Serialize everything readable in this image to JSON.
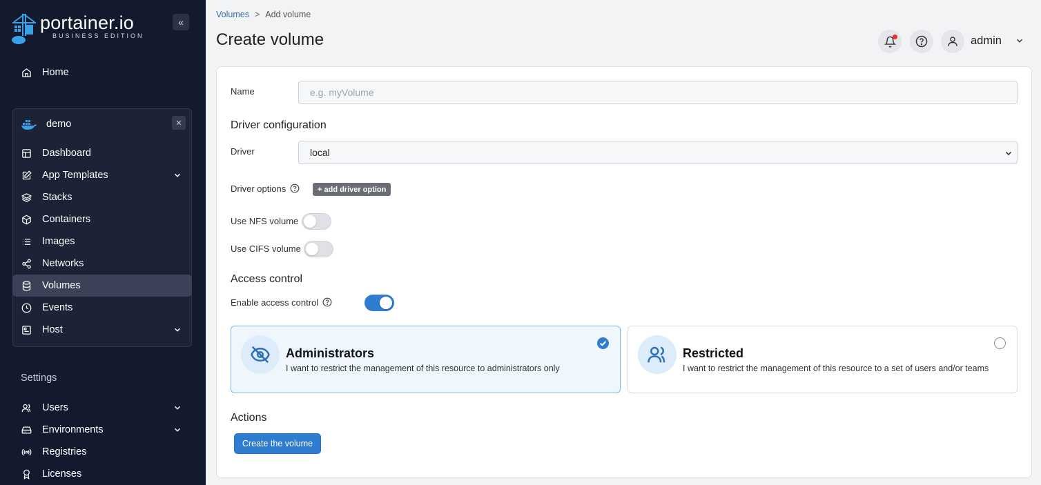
{
  "brand": {
    "name": "portainer.io",
    "edition": "BUSINESS EDITION"
  },
  "sidebar": {
    "home_label": "Home",
    "environment": {
      "name": "demo",
      "items": [
        {
          "label": "Dashboard",
          "icon": "dashboard-icon"
        },
        {
          "label": "App Templates",
          "icon": "edit-icon"
        },
        {
          "label": "Stacks",
          "icon": "layers-icon"
        },
        {
          "label": "Containers",
          "icon": "box-icon"
        },
        {
          "label": "Images",
          "icon": "list-icon"
        },
        {
          "label": "Networks",
          "icon": "share-icon"
        },
        {
          "label": "Volumes",
          "icon": "database-icon"
        },
        {
          "label": "Events",
          "icon": "clock-icon"
        },
        {
          "label": "Host",
          "icon": "host-icon"
        }
      ]
    },
    "settings_label": "Settings",
    "settings_items": [
      {
        "label": "Users"
      },
      {
        "label": "Environments"
      },
      {
        "label": "Registries"
      },
      {
        "label": "Licenses"
      }
    ]
  },
  "breadcrumb": {
    "parent": "Volumes",
    "separator": ">",
    "current": "Add volume"
  },
  "page": {
    "title": "Create volume",
    "user": "admin"
  },
  "form": {
    "name_label": "Name",
    "name_placeholder": "e.g. myVolume",
    "driver_section": "Driver configuration",
    "driver_label": "Driver",
    "driver_value": "local",
    "driver_options_label": "Driver options",
    "add_driver_option": "+ add driver option",
    "nfs_label": "Use NFS volume",
    "cifs_label": "Use CIFS volume",
    "access_section": "Access control",
    "enable_access_label": "Enable access control",
    "nfs_enabled": false,
    "cifs_enabled": false,
    "access_enabled": true
  },
  "access_options": [
    {
      "title": "Administrators",
      "description": "I want to restrict the management of this resource to administrators only",
      "selected": true
    },
    {
      "title": "Restricted",
      "description": "I want to restrict the management of this resource to a set of users and/or teams",
      "selected": false
    }
  ],
  "actions": {
    "section": "Actions",
    "create_label": "Create the volume"
  },
  "colors": {
    "sidebar_bg": "#131a2e",
    "primary": "#2e7dd1",
    "notification_dot": "#e5302f"
  }
}
